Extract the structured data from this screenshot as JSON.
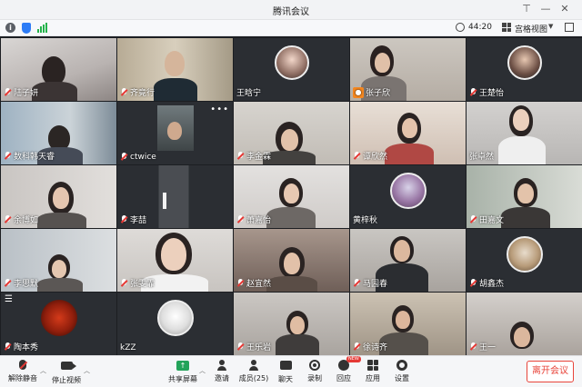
{
  "window": {
    "title": "腾讯会议"
  },
  "info_bar": {
    "timer": "44:20",
    "view_mode": "宫格视图"
  },
  "participants": [
    {
      "name": "陆子妍",
      "muted": true
    },
    {
      "name": "齐竟行",
      "muted": true
    },
    {
      "name": "王晗宁",
      "muted": false
    },
    {
      "name": "张子欣",
      "muted": true,
      "badge": "person-icon"
    },
    {
      "name": "王楚怡",
      "muted": true
    },
    {
      "name": "数科韩天睿",
      "muted": true
    },
    {
      "name": "ctwice",
      "muted": true
    },
    {
      "name": "李金霖",
      "muted": true
    },
    {
      "name": "谭欣然",
      "muted": true
    },
    {
      "name": "张卓然",
      "muted": false
    },
    {
      "name": "余博如",
      "muted": true
    },
    {
      "name": "李喆",
      "muted": true
    },
    {
      "name": "萧嘉怡",
      "muted": true
    },
    {
      "name": "黄梓秋",
      "muted": false
    },
    {
      "name": "田嘉文",
      "muted": true
    },
    {
      "name": "李思默",
      "muted": true
    },
    {
      "name": "张雯霏",
      "muted": true
    },
    {
      "name": "赵宜然",
      "muted": true
    },
    {
      "name": "马园春",
      "muted": true
    },
    {
      "name": "胡鑫杰",
      "muted": true
    },
    {
      "name": "陶本秀",
      "muted": true
    },
    {
      "name": "kZZ",
      "muted": false
    },
    {
      "name": "王乐岩",
      "muted": true
    },
    {
      "name": "徐诗齐",
      "muted": true
    },
    {
      "name": "王一",
      "muted": true
    }
  ],
  "toolbar": {
    "unmute_label": "解除静音",
    "stop_video_label": "停止视频",
    "share_label": "共享屏幕",
    "invite_label": "邀请",
    "members_label": "成员(25)",
    "chat_label": "聊天",
    "record_label": "录制",
    "react_label": "回应",
    "apps_label": "应用",
    "apps_badge": "NEW",
    "settings_label": "设置",
    "leave_label": "离开会议"
  },
  "colors": {
    "accent_blue": "#2d7cf6",
    "signal_green": "#24b34b",
    "share_green": "#23a35a",
    "leave_red": "#e8443a"
  }
}
